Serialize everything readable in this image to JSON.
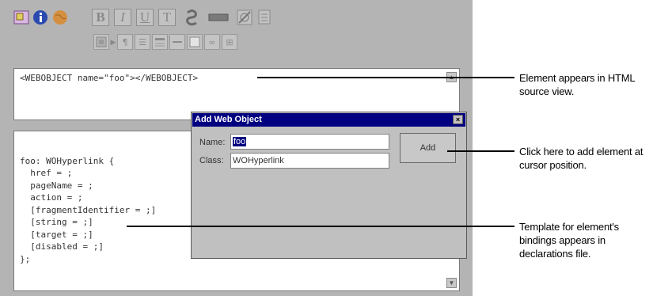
{
  "toolbar": {
    "row1_icons": [
      "web-object-icon",
      "info-icon",
      "globe-icon"
    ],
    "format_buttons": [
      "B",
      "I",
      "U",
      "T"
    ],
    "row2_glyphs": {
      "paragraph": "¶",
      "list": "☰",
      "link": "∞",
      "table": "⊞"
    }
  },
  "source_view": {
    "text": "<WEBOBJECT name=\"foo\"></WEBOBJECT>"
  },
  "declarations": {
    "lines": [
      "foo: WOHyperlink {",
      "  href = ;",
      "  pageName = ;",
      "  action = ;",
      "  [fragmentIdentifier = ;]",
      "  [string = ;]",
      "  [target = ;]",
      "  [disabled = ;]",
      "};"
    ]
  },
  "dialog": {
    "title": "Add Web Object",
    "close_glyph": "×",
    "name_label": "Name:",
    "name_value": "foo",
    "class_label": "Class:",
    "class_value": "WOHyperlink",
    "add_label": "Add"
  },
  "callouts": {
    "source": "Element appears in HTML source view.",
    "add": "Click here to add element at cursor position.",
    "template": "Template for element's bindings appears in declarations file."
  }
}
